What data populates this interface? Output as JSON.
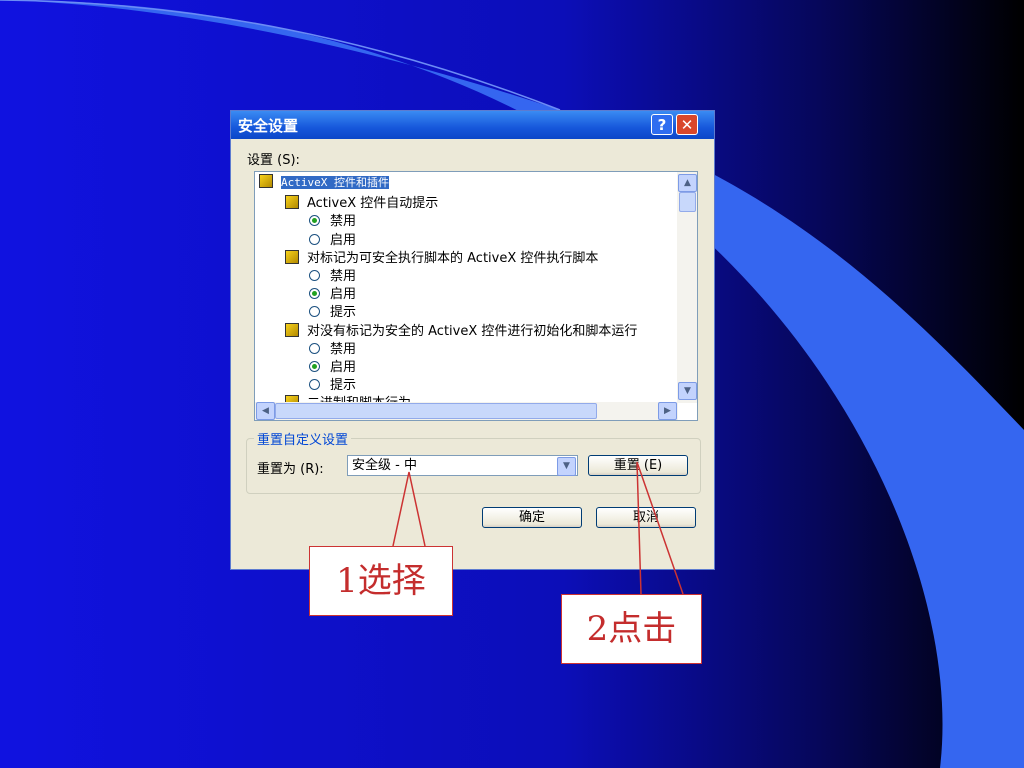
{
  "dialog": {
    "title": "安全设置",
    "help_label": "?",
    "close_label": "✕",
    "settings_label": "设置 (S):",
    "tree": [
      {
        "kind": "category",
        "text": "ActiveX 控件和插件",
        "selected": true
      },
      {
        "kind": "setting",
        "text": "ActiveX 控件自动提示"
      },
      {
        "kind": "option",
        "text": "禁用",
        "checked": true
      },
      {
        "kind": "option",
        "text": "启用",
        "checked": false
      },
      {
        "kind": "setting",
        "text": "对标记为可安全执行脚本的 ActiveX 控件执行脚本"
      },
      {
        "kind": "option",
        "text": "禁用",
        "checked": false
      },
      {
        "kind": "option",
        "text": "启用",
        "checked": true
      },
      {
        "kind": "option",
        "text": "提示",
        "checked": false
      },
      {
        "kind": "setting",
        "text": "对没有标记为安全的 ActiveX 控件进行初始化和脚本运行"
      },
      {
        "kind": "option",
        "text": "禁用",
        "checked": false
      },
      {
        "kind": "option",
        "text": "启用",
        "checked": true
      },
      {
        "kind": "option",
        "text": "提示",
        "checked": false
      },
      {
        "kind": "setting",
        "text": "二进制和脚本行为"
      }
    ],
    "reset_group_title": "重置自定义设置",
    "reset_to_label": "重置为 (R):",
    "reset_level_value": "安全级 - 中",
    "reset_button_label": "重置 (E)",
    "ok_button_label": "确定",
    "cancel_button_label": "取消"
  },
  "callouts": {
    "select": "1选择",
    "click": "2点击"
  },
  "colors": {
    "background": "#0f11d6",
    "dialog_face": "#ece9d8",
    "titlebar": "#1657db",
    "callout_red": "#c42d2d"
  }
}
